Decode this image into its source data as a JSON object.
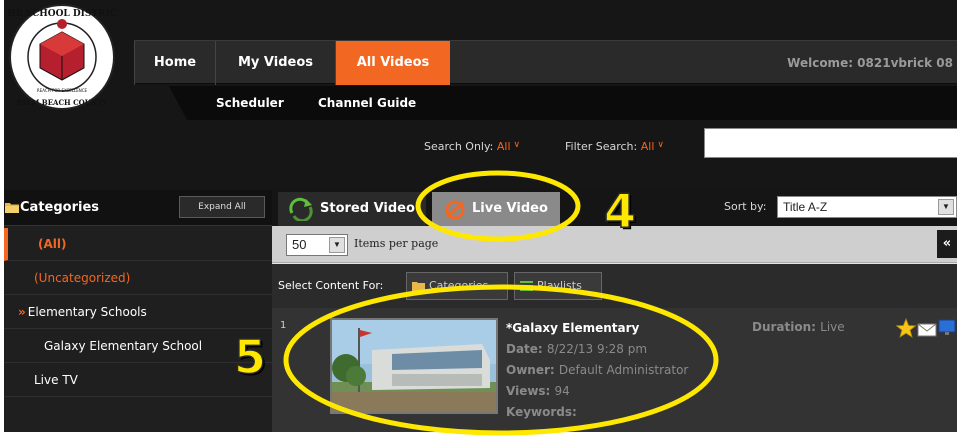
{
  "logo": {
    "text_top": "THE SCHOOL DISTRICT",
    "text_bottom": "PALM BEACH COUNTY",
    "motto": "REACH FOR EXCELLENCE"
  },
  "nav": {
    "home": "Home",
    "my_videos": "My Videos",
    "all_videos": "All Videos",
    "welcome": "Welcome: 0821vbrick 08",
    "accent": "#f26722"
  },
  "subnav": {
    "scheduler": "Scheduler",
    "channel_guide": "Channel Guide"
  },
  "search": {
    "search_only_label": "Search Only:",
    "search_only_value": "All",
    "filter_label": "Filter Search:",
    "filter_value": "All",
    "query": ""
  },
  "sidebar": {
    "title": "Categories",
    "expand_all": "Expand All",
    "items": [
      {
        "label": "(All)"
      },
      {
        "label": "(Uncategorized)"
      },
      {
        "label": "Elementary Schools",
        "prefix": "»"
      },
      {
        "label": "Galaxy Elementary School"
      },
      {
        "label": "Live TV"
      }
    ]
  },
  "tabs": {
    "stored": "Stored Video",
    "live": "Live Video"
  },
  "sort": {
    "label": "Sort by:",
    "value": "Title A-Z"
  },
  "paging": {
    "per_page_value": "50",
    "per_page_label": "Items per page",
    "collapse": "«"
  },
  "select_content": {
    "label": "Select Content For:",
    "categories": "Categories",
    "playlists": "Playlists"
  },
  "result": {
    "index": "1",
    "title": "*Galaxy Elementary",
    "date_label": "Date:",
    "date_value": "8/22/13 9:28 pm",
    "owner_label": "Owner:",
    "owner_value": "Default Administrator",
    "views_label": "Views:",
    "views_value": "94",
    "keywords_label": "Keywords:",
    "duration_label": "Duration:",
    "duration_value": "Live",
    "icons": [
      "star-icon",
      "mail-icon",
      "monitor-icon"
    ]
  },
  "annotations": {
    "callout_4": "4",
    "callout_5": "5",
    "color": "#ffe800"
  }
}
